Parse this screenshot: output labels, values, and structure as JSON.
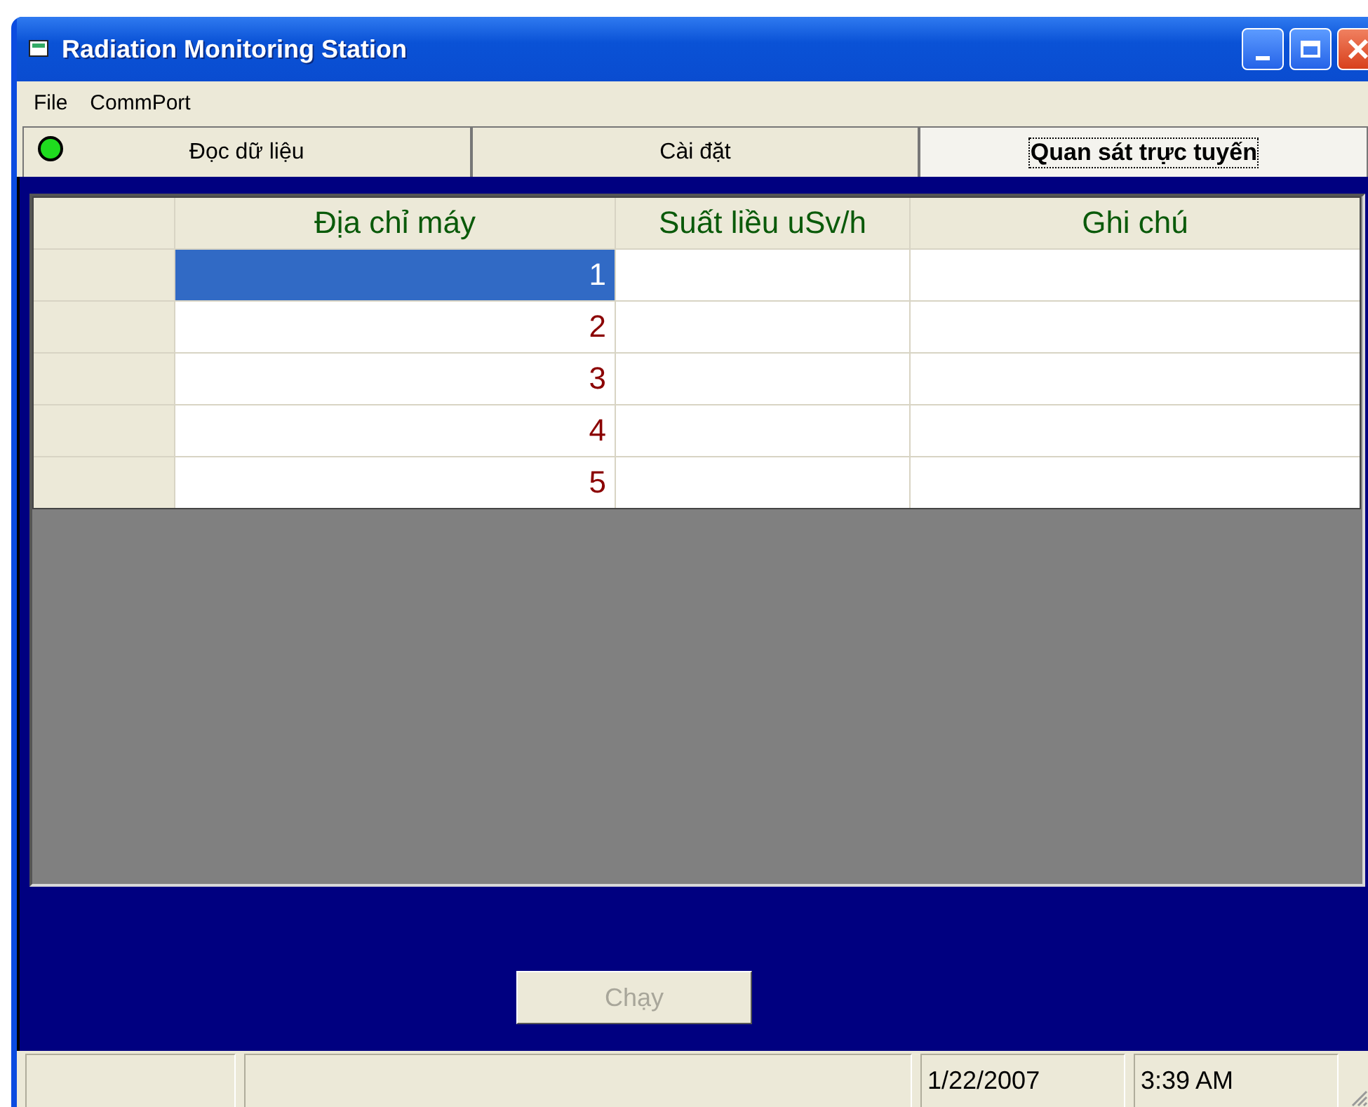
{
  "window": {
    "title": "Radiation Monitoring Station"
  },
  "menu": [
    "File",
    "CommPort"
  ],
  "tabs": [
    {
      "label": "Đọc dữ liệu",
      "selected": false,
      "led_on": true
    },
    {
      "label": "Cài đặt",
      "selected": false
    },
    {
      "label": "Quan sát trực tuyến",
      "selected": true
    }
  ],
  "table": {
    "columns": [
      "Địa chỉ máy",
      "Suất liều uSv/h",
      "Ghi chú"
    ],
    "rows": [
      {
        "address": "1",
        "selected": true
      },
      {
        "address": "2",
        "selected": false
      },
      {
        "address": "3",
        "selected": false
      },
      {
        "address": "4",
        "selected": false
      },
      {
        "address": "5",
        "selected": false
      }
    ]
  },
  "run_button": {
    "label": "Chạy",
    "disabled": true
  },
  "status_bar": [
    "1/22/2007",
    "3:39 AM"
  ]
}
